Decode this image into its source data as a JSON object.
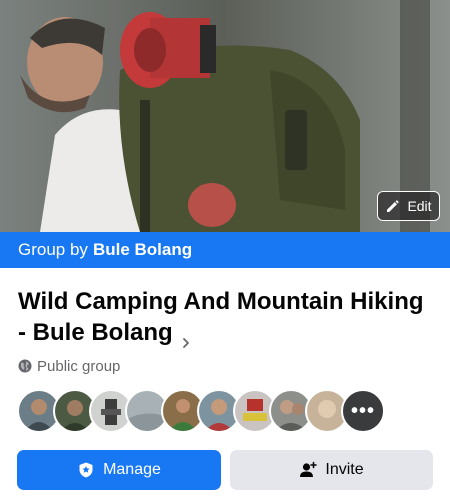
{
  "cover": {
    "edit_label": "Edit"
  },
  "banner": {
    "prefix": "Group by",
    "owner": "Bule Bolang",
    "color": "#1877f2"
  },
  "group": {
    "title": "Wild Camping And Mountain Hiking - Bule Bolang",
    "privacy": "Public group"
  },
  "members": {
    "avatars": [
      {
        "name": "member-avatar-1",
        "color": "#6b7d86"
      },
      {
        "name": "member-avatar-2",
        "color": "#4c5a44"
      },
      {
        "name": "member-avatar-3",
        "color": "#cfd2cf"
      },
      {
        "name": "member-avatar-4",
        "color": "#a7b1b6"
      },
      {
        "name": "member-avatar-5",
        "color": "#8a6d49"
      },
      {
        "name": "member-avatar-6",
        "color": "#7d93a0"
      },
      {
        "name": "member-avatar-7",
        "color": "#c9c4c2"
      },
      {
        "name": "member-avatar-8",
        "color": "#8c8f8a"
      },
      {
        "name": "member-avatar-9",
        "color": "#c7b39a"
      },
      {
        "name": "member-avatar-10",
        "color": "#a8a29a"
      }
    ],
    "more_label": "•••"
  },
  "actions": {
    "manage_label": "Manage",
    "invite_label": "Invite"
  },
  "icons": {
    "edit": "pencil-icon",
    "chevron": "chevron-right-icon",
    "privacy": "globe-icon",
    "manage": "shield-star-icon",
    "invite": "add-person-icon"
  }
}
